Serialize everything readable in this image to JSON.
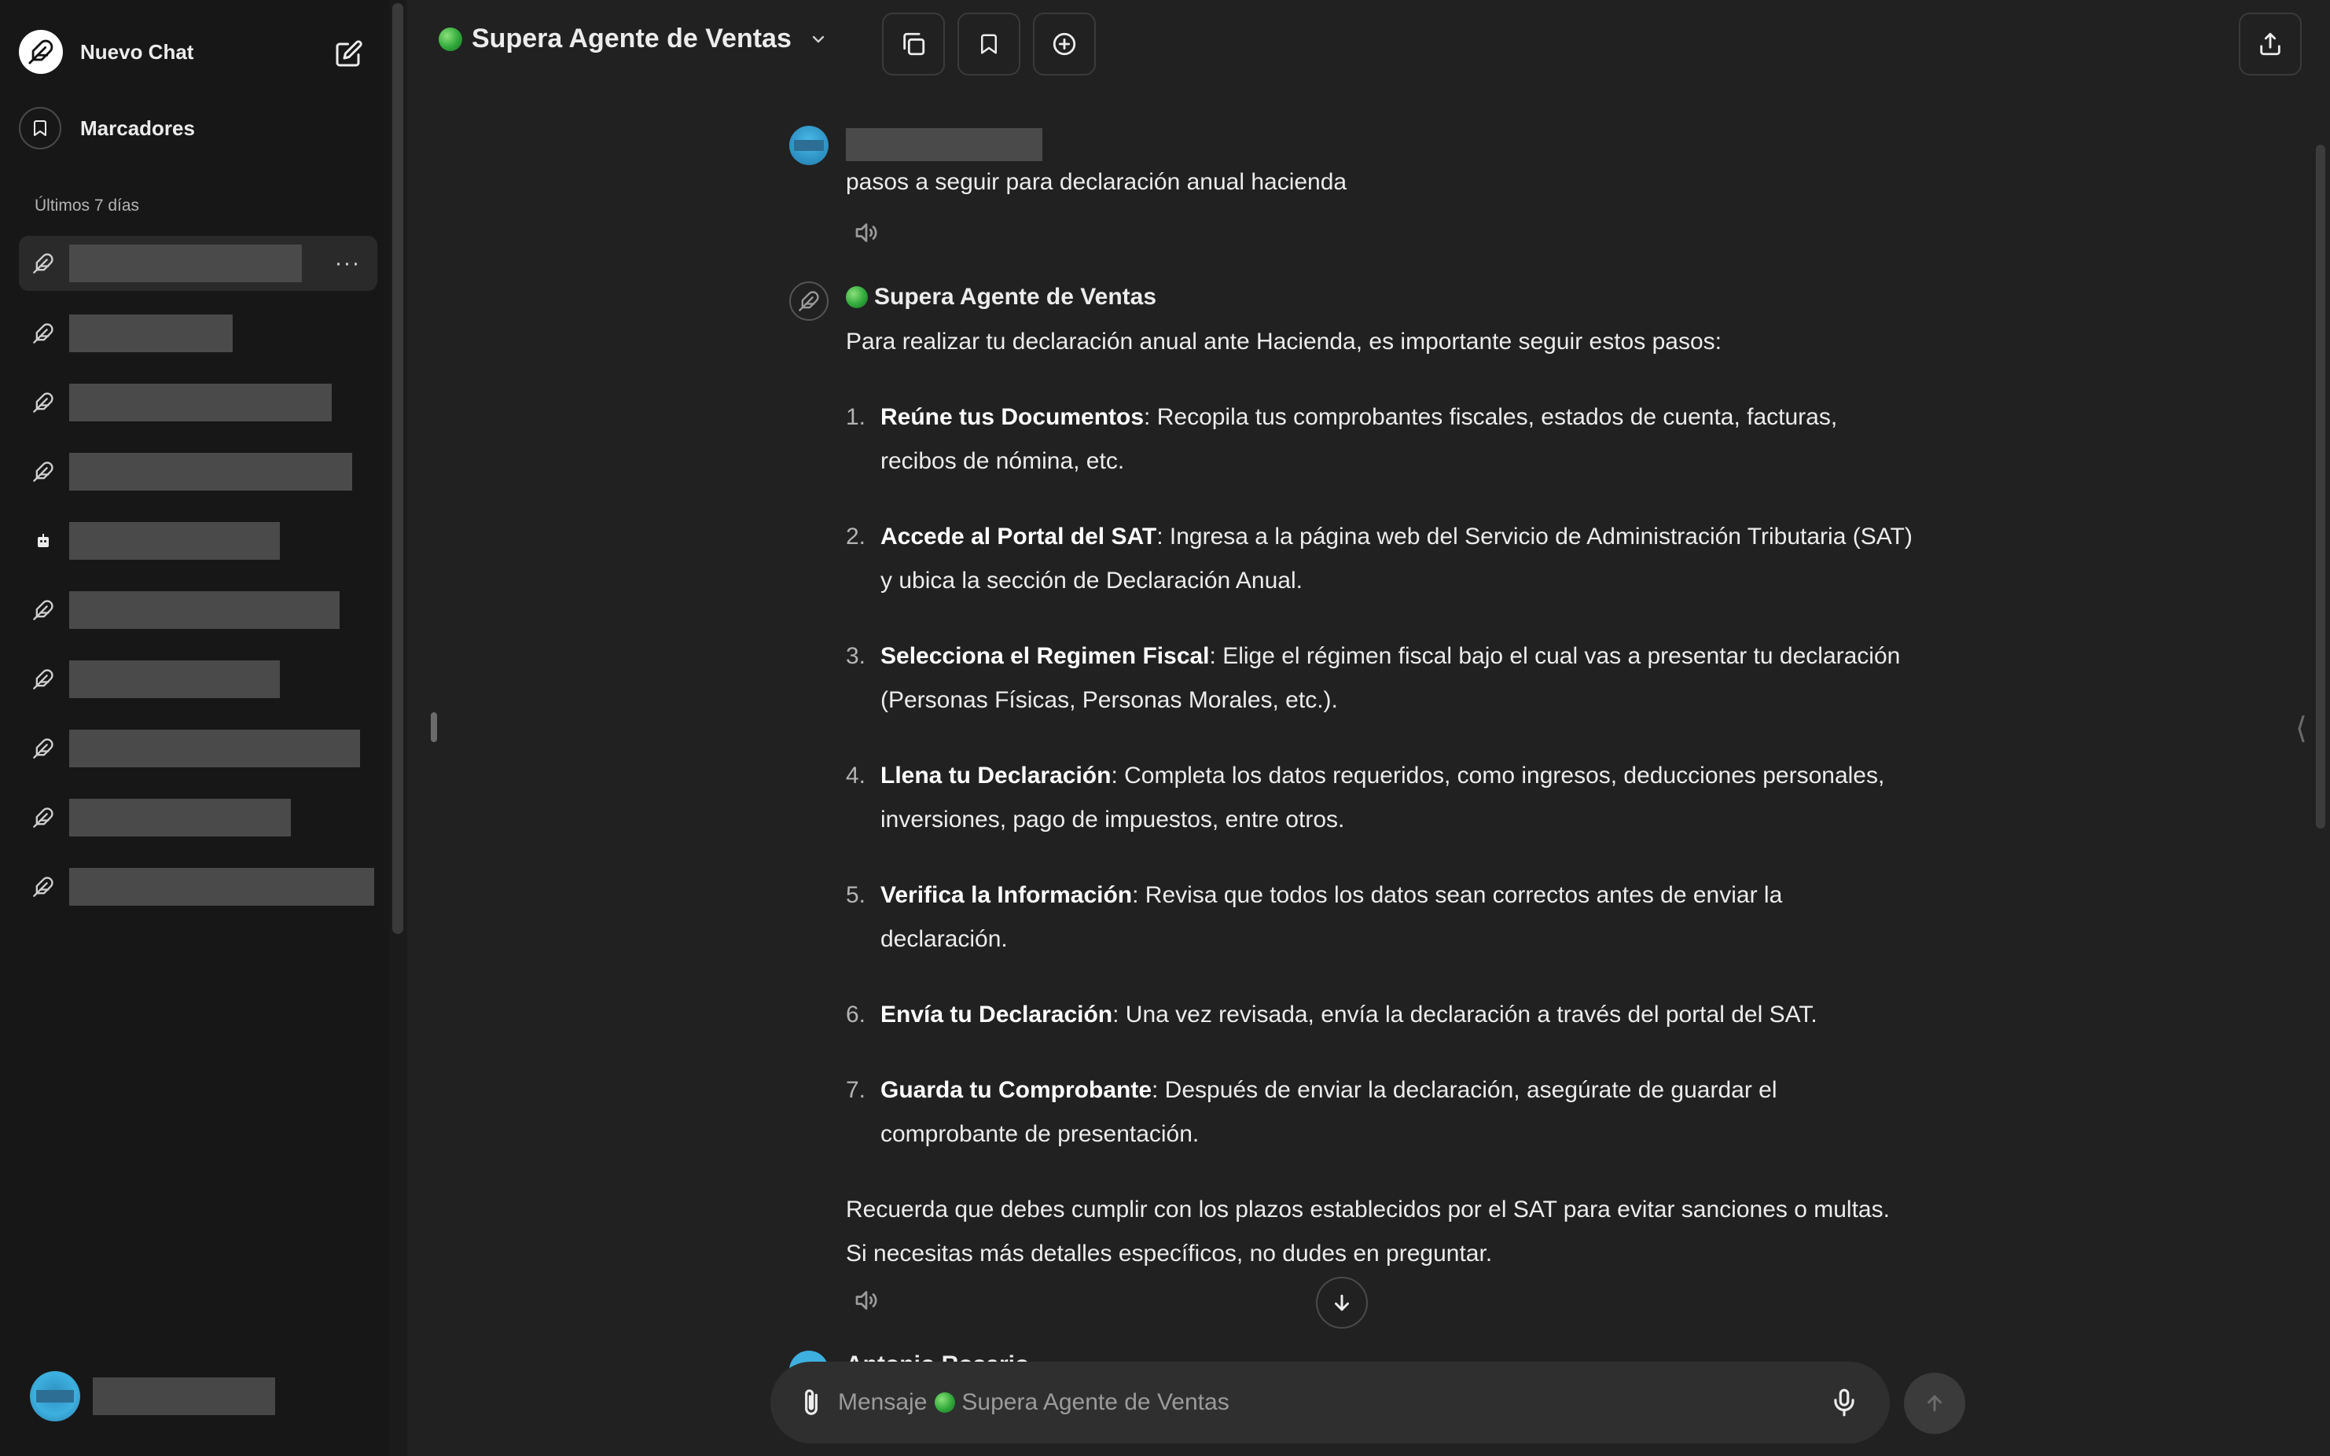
{
  "sidebar": {
    "new_chat_label": "Nuevo Chat",
    "bookmarks_label": "Marcadores",
    "section_label": "Últimos 7 días",
    "more_label": "···"
  },
  "header": {
    "model_name": "Supera Agente de Ventas"
  },
  "conversation": {
    "user_message": "pasos a seguir para declaración anual hacienda",
    "bot_name": "Supera Agente de Ventas",
    "bot_intro": "Para realizar tu declaración anual ante Hacienda, es importante seguir estos pasos:",
    "steps": [
      {
        "num": "1.",
        "title": "Reúne tus Documentos",
        "text": ": Recopila tus comprobantes fiscales, estados de cuenta, facturas, recibos de nómina, etc."
      },
      {
        "num": "2.",
        "title": "Accede al Portal del SAT",
        "text": ": Ingresa a la página web del Servicio de Administración Tributaria (SAT) y ubica la sección de Declaración Anual."
      },
      {
        "num": "3.",
        "title": "Selecciona el Regimen Fiscal",
        "text": ": Elige el régimen fiscal bajo el cual vas a presentar tu declaración (Personas Físicas, Personas Morales, etc.)."
      },
      {
        "num": "4.",
        "title": "Llena tu Declaración",
        "text": ": Completa los datos requeridos, como ingresos, deducciones personales, inversiones, pago de impuestos, entre otros."
      },
      {
        "num": "5.",
        "title": "Verifica la Información",
        "text": ": Revisa que todos los datos sean correctos antes de enviar la declaración."
      },
      {
        "num": "6.",
        "title": "Envía tu Declaración",
        "text": ": Una vez revisada, envía la declaración a través del portal del SAT."
      },
      {
        "num": "7.",
        "title": "Guarda tu Comprobante",
        "text": ": Después de enviar la declaración, asegúrate de guardar el comprobante de presentación."
      }
    ],
    "bot_outro": "Recuerda que debes cumplir con los plazos establecidos por el SAT para evitar sanciones o multas. Si necesitas más detalles específicos, no dudes en preguntar.",
    "next_sender_partial": "Antonio Rosario"
  },
  "composer": {
    "placeholder_prefix": "Mensaje",
    "placeholder_model": "Supera Agente de Ventas"
  },
  "colors": {
    "background": "#212121",
    "sidebar": "#171717",
    "composer": "#2f2f2f",
    "accent_green": "#2fa83a"
  }
}
